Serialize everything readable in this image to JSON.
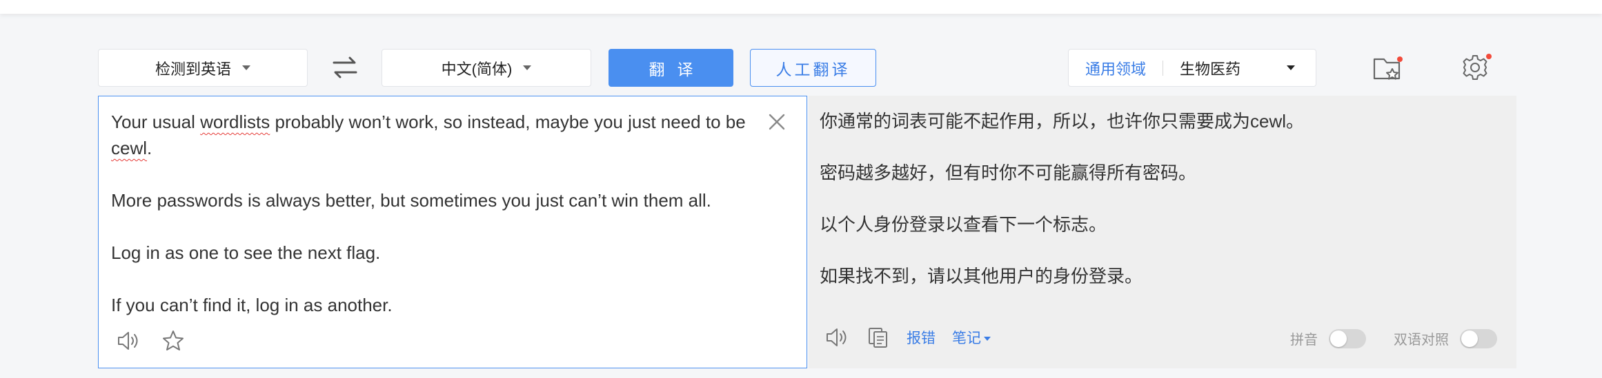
{
  "toolbar": {
    "source_lang": "检测到英语",
    "target_lang": "中文(简体)",
    "translate_label": "翻译",
    "human_translate_label": "人工翻译",
    "domain_general": "通用领域",
    "domain_selected": "生物医药"
  },
  "source": {
    "paragraphs": [
      [
        "Your usual ",
        "wordlists",
        " probably won’t work, so instead, maybe you just need to be ",
        "cewl",
        "."
      ],
      "More passwords is always better, but sometimes you just can’t win them all.",
      "Log in as one to see the next flag.",
      "If you can’t find it, log in as another."
    ]
  },
  "target": {
    "paragraphs": [
      "你通常的词表可能不起作用，所以，也许你只需要成为cewl。",
      "密码越多越好，但有时你不可能赢得所有密码。",
      "以个人身份登录以查看下一个标志。",
      "如果找不到，请以其他用户的身份登录。"
    ],
    "report_label": "报错",
    "notes_label": "笔记",
    "pinyin_label": "拼音",
    "bilingual_label": "双语对照"
  },
  "icons": {
    "swap": "swap-arrows-icon",
    "favorites": "favorites-folder-icon",
    "settings": "gear-icon",
    "clear": "close-icon",
    "speaker": "speaker-icon",
    "star": "star-icon",
    "copy": "copy-icon"
  },
  "colors": {
    "accent": "#4a8ff0",
    "badge": "#f24a3a"
  }
}
